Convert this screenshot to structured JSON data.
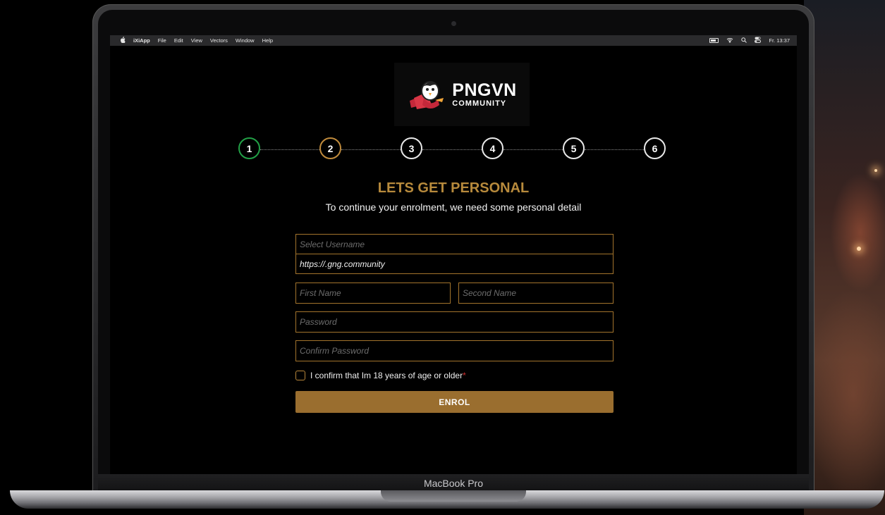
{
  "menubar": {
    "app_name": "iXiApp",
    "menus": [
      "File",
      "Edit",
      "View",
      "Vectors",
      "Window",
      "Help"
    ],
    "clock": "Fr. 13:37"
  },
  "logo": {
    "title": "PNGVN",
    "subtitle": "COMMUNITY"
  },
  "stepper": {
    "steps": [
      {
        "label": "1",
        "state": "completed",
        "color": "#22a046"
      },
      {
        "label": "2",
        "state": "current",
        "color": "#c08b3c"
      },
      {
        "label": "3",
        "state": "pending",
        "color": "#e8e8e8"
      },
      {
        "label": "4",
        "state": "pending",
        "color": "#e8e8e8"
      },
      {
        "label": "5",
        "state": "pending",
        "color": "#e8e8e8"
      },
      {
        "label": "6",
        "state": "pending",
        "color": "#e8e8e8"
      }
    ]
  },
  "form": {
    "heading": "LETS GET PERSONAL",
    "subheading": "To continue your enrolment, we need some personal detail",
    "username_placeholder": "Select Username",
    "url_value": "https://.gng.community",
    "first_name_placeholder": "First Name",
    "second_name_placeholder": "Second Name",
    "password_placeholder": "Password",
    "confirm_password_placeholder": "Confirm Password",
    "age_confirm_label": "I confirm that Im 18 years of age or older",
    "required_mark": "*",
    "submit_label": "ENROL"
  },
  "device": {
    "label": "MacBook Pro"
  },
  "colors": {
    "accent": "#b78a3c",
    "button": "#9a6e2f",
    "field_border": "#a3742c"
  }
}
